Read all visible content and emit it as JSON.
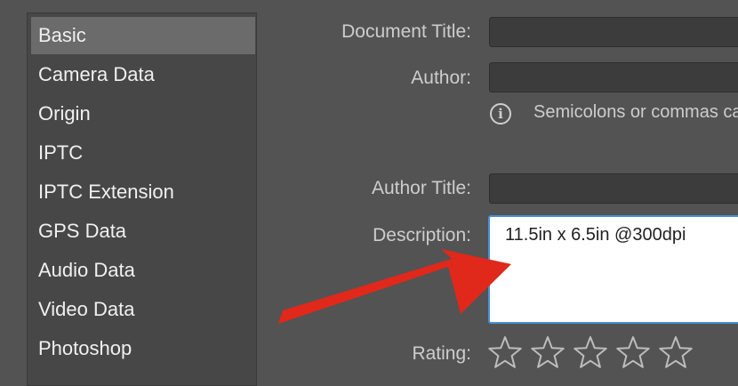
{
  "sidebar": {
    "items": [
      {
        "label": "Basic",
        "selected": true
      },
      {
        "label": "Camera Data"
      },
      {
        "label": "Origin"
      },
      {
        "label": "IPTC"
      },
      {
        "label": "IPTC Extension"
      },
      {
        "label": "GPS Data"
      },
      {
        "label": "Audio Data"
      },
      {
        "label": "Video Data"
      },
      {
        "label": "Photoshop"
      }
    ]
  },
  "form": {
    "document_title_label": "Document Title:",
    "document_title_value": "",
    "author_label": "Author:",
    "author_value": "",
    "info_text": "Semicolons or commas ca",
    "author_title_label": "Author Title:",
    "author_title_value": "",
    "description_label": "Description:",
    "description_value": "11.5in x 6.5in @300dpi",
    "rating_label": "Rating:",
    "rating_value": 0,
    "rating_max": 5
  },
  "colors": {
    "background": "#535353",
    "sidebar_bg": "#474747",
    "selected_bg": "#6b6b6b",
    "focus_border": "#4a90d9",
    "annotation_arrow": "#e0281b"
  },
  "icons": [
    "info-icon",
    "star-outline-icon",
    "red-annotation-arrow"
  ]
}
